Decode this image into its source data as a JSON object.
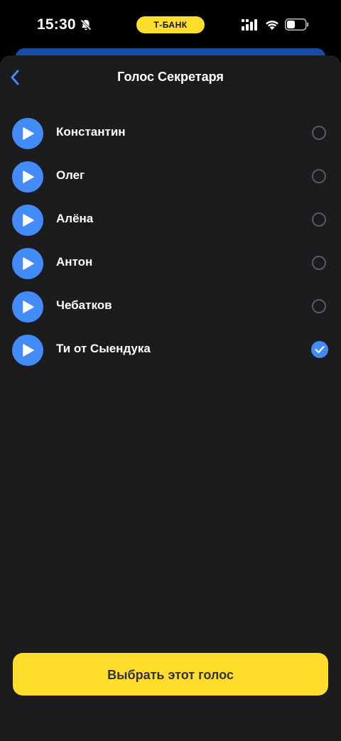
{
  "status_bar": {
    "time": "15:30",
    "bank_badge": "Т-БАНК",
    "icons": [
      "bell-muted-icon",
      "signal-icon",
      "wifi-icon",
      "battery-icon"
    ]
  },
  "header": {
    "title": "Голос Секретаря",
    "back_icon": "chevron-left-icon"
  },
  "voices": [
    {
      "name": "Константин",
      "selected": false
    },
    {
      "name": "Олег",
      "selected": false
    },
    {
      "name": "Алёна",
      "selected": false
    },
    {
      "name": "Антон",
      "selected": false
    },
    {
      "name": "Чебатков",
      "selected": false
    },
    {
      "name": "Ти от Сыендука",
      "selected": true
    }
  ],
  "cta": {
    "label": "Выбрать этот голос"
  },
  "colors": {
    "accent_blue": "#428BF9",
    "brand_yellow": "#FFDD2D",
    "sheet_bg": "#1C1C1E",
    "background": "#000000"
  }
}
